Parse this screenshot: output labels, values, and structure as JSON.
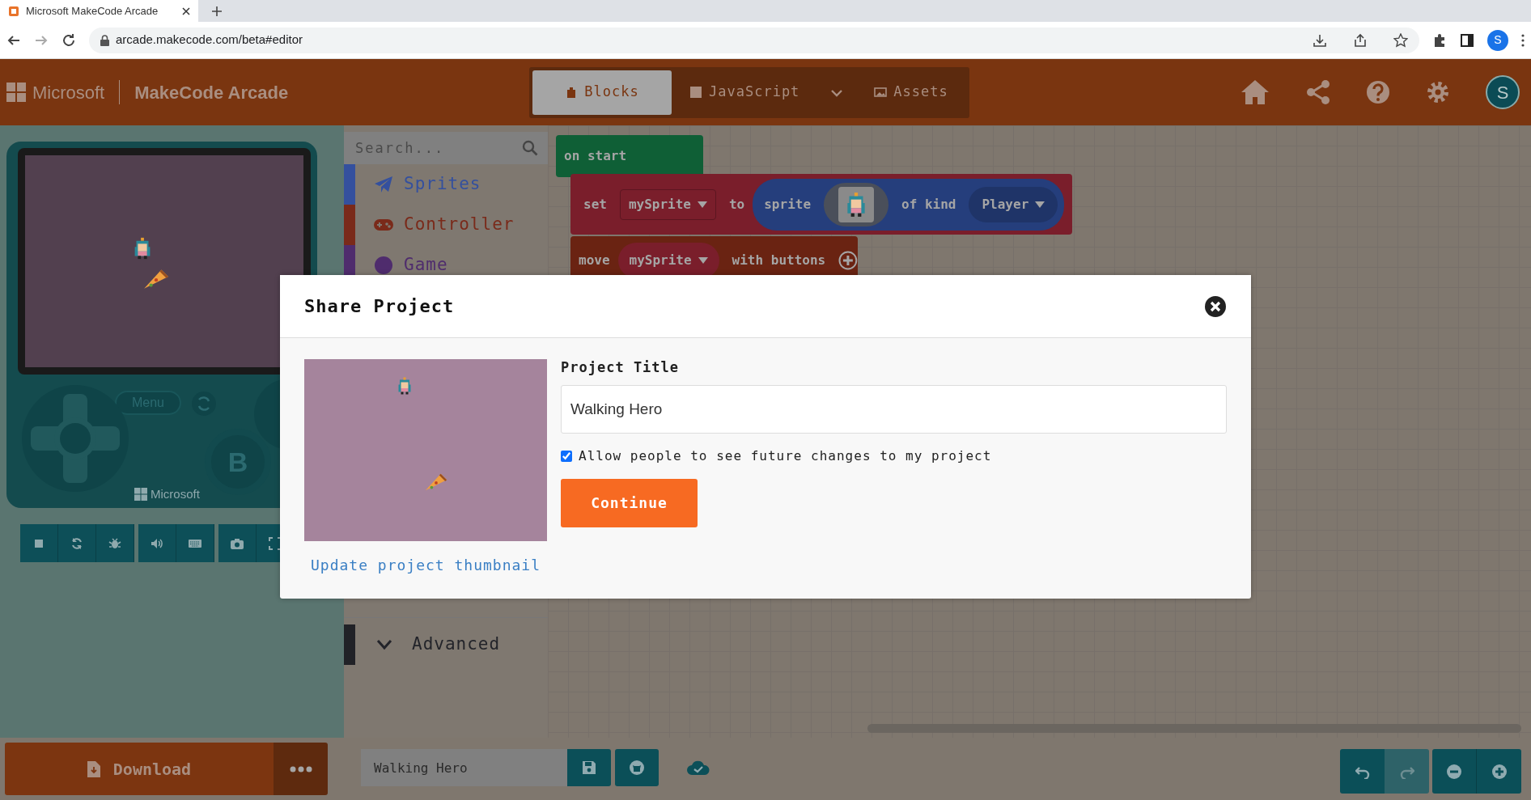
{
  "browser": {
    "tab_title": "Microsoft MakeCode Arcade",
    "url": "arcade.makecode.com/beta#editor",
    "profile_initial": "S"
  },
  "header": {
    "brand": "Microsoft",
    "product": "MakeCode Arcade",
    "avatar": "S",
    "tabs": [
      {
        "label": "Blocks",
        "kind": "blocks",
        "selected": true
      },
      {
        "label": "JavaScript",
        "kind": "javascript",
        "selected": false
      },
      {
        "label": "Assets",
        "kind": "assets",
        "selected": false
      }
    ]
  },
  "simulator": {
    "menu_label": "Menu",
    "b_label": "B",
    "brand": "Microsoft"
  },
  "toolbox": {
    "placeholder": "Search...",
    "advanced": "Advanced",
    "categories": [
      {
        "label": "Sprites",
        "kind": "plane",
        "color": "#34509e"
      },
      {
        "label": "Controller",
        "kind": "gamepad",
        "color": "#7a2a1a"
      },
      {
        "label": "Game",
        "kind": "circle",
        "color": "#4f2c6d"
      }
    ]
  },
  "blocks": {
    "hat": "on start",
    "set": {
      "keyword": "set",
      "variable": "mySprite",
      "to": "to",
      "sprite": "sprite",
      "of_kind": "of kind",
      "kind_value": "Player"
    },
    "move": {
      "keyword": "move",
      "variable": "mySprite",
      "with_buttons": "with buttons"
    }
  },
  "bottom": {
    "download": "Download",
    "project_name": "Walking Hero"
  },
  "dialog": {
    "title": "Share Project",
    "field_label": "Project Title",
    "title_value": "Walking Hero",
    "allow_changes": {
      "label": "Allow people to see future changes to my project",
      "checked": true
    },
    "continue": "Continue",
    "update_link": "Update project thumbnail"
  }
}
